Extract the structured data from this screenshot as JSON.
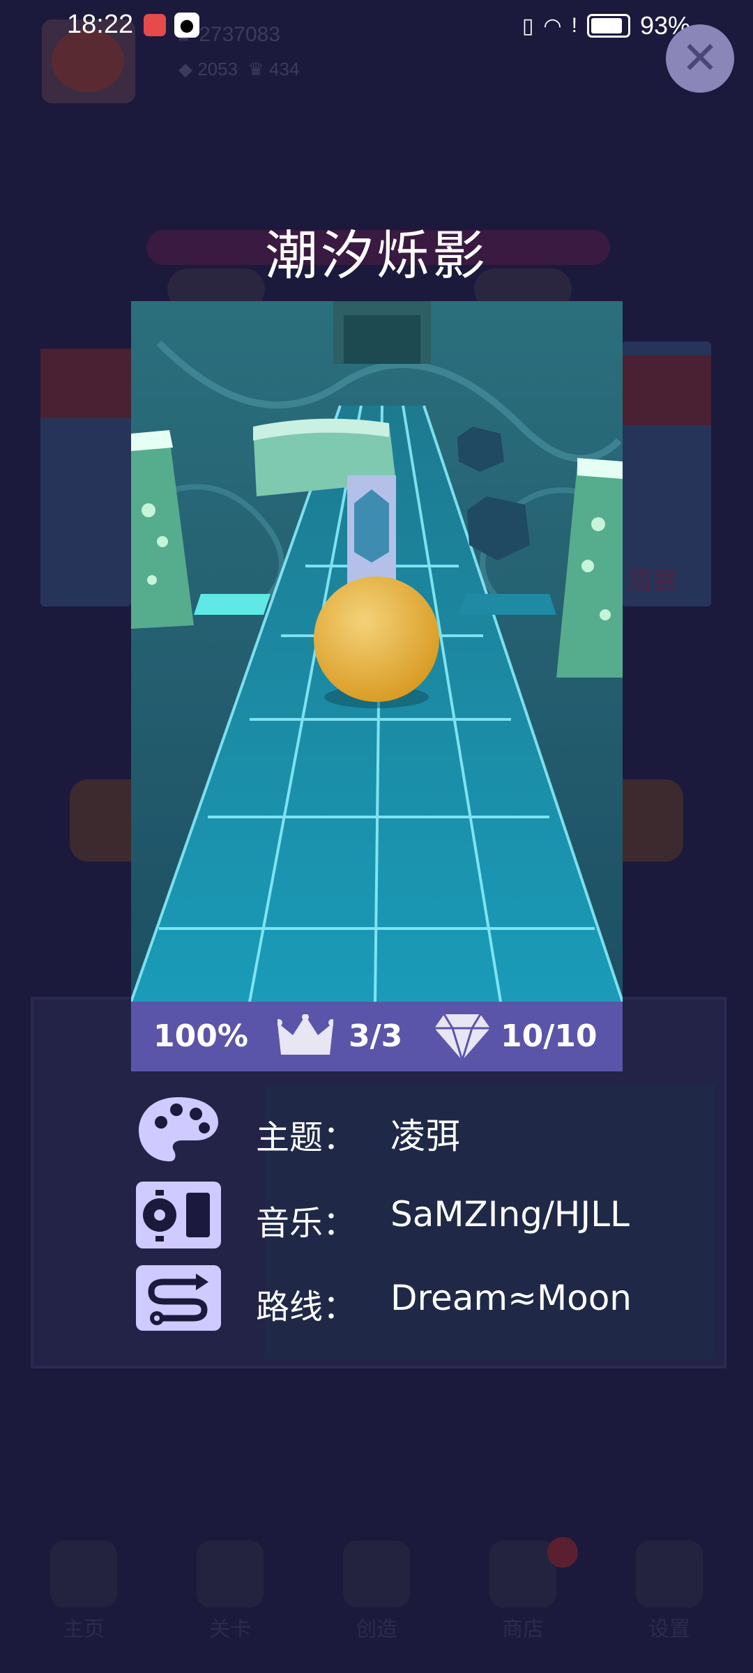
{
  "status_bar": {
    "time": "18:22",
    "battery": "93%"
  },
  "background": {
    "score": "2737083",
    "gems": "2053",
    "crowns": "434",
    "weekly_label": "周赛",
    "tabs": [
      "主页",
      "关卡",
      "创造",
      "商店",
      "设置"
    ]
  },
  "modal": {
    "title": "潮汐烁影",
    "stats": {
      "percent": "100%",
      "crowns": "3/3",
      "gems": "10/10"
    },
    "info": [
      {
        "label": "主题：",
        "value": "凌弭",
        "icon": "palette-icon"
      },
      {
        "label": "音乐：",
        "value": "SaMZIng/HJLL",
        "icon": "music-player-icon"
      },
      {
        "label": "路线：",
        "value": "Dream≈Moon",
        "icon": "route-icon"
      }
    ]
  },
  "colors": {
    "backdrop": "#1b1a3c",
    "stats_bar": "#5a55a8",
    "icon_fill": "#cfcaff",
    "ball": "#e0a52a"
  }
}
